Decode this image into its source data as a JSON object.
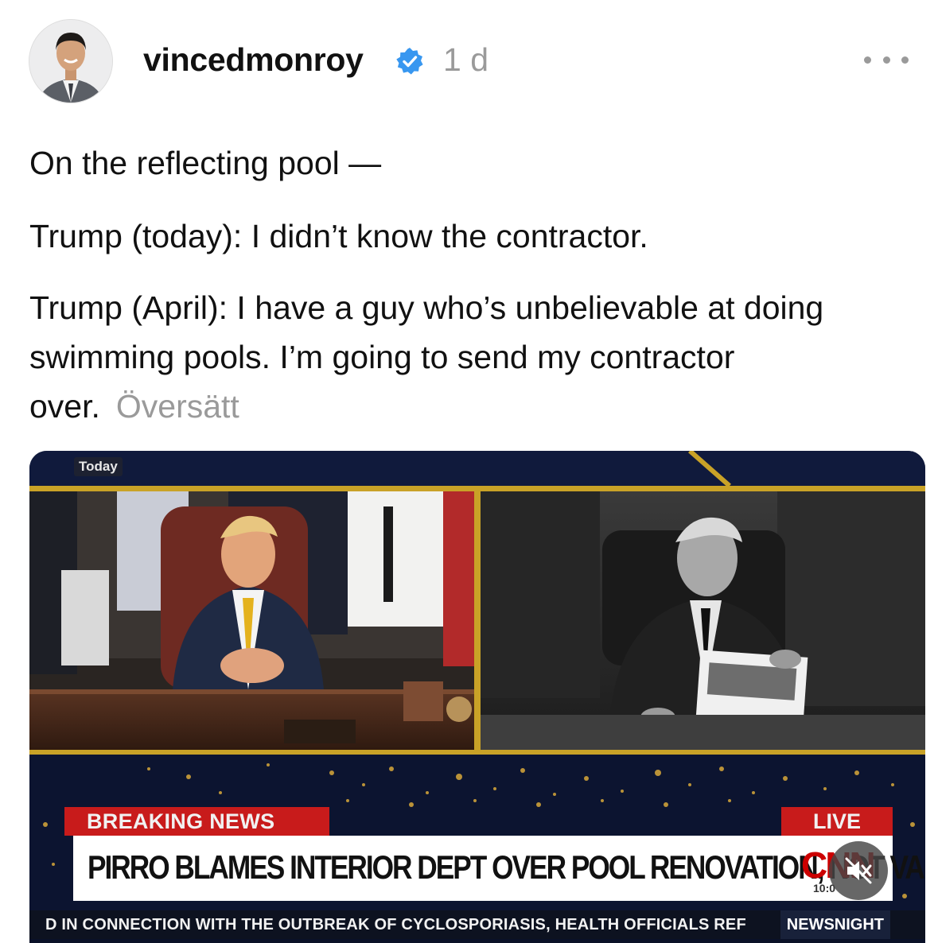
{
  "post": {
    "username": "vincedmonroy",
    "time_ago": "1 d",
    "lines": {
      "intro": "On the reflecting pool —",
      "today": "Trump (today): I didn’t know the contractor.",
      "april": "Trump (April): I have a guy who’s unbelievable at doing swimming pools. I’m going to send my contractor over."
    },
    "translate_label": "Översätt"
  },
  "icons": {
    "verified": "verified-badge-icon",
    "more": "more-options-icon",
    "mute": "muted-speaker-icon"
  },
  "video": {
    "corner_label": "Today",
    "breaking_label": "BREAKING NEWS",
    "live_label": "LIVE",
    "headline": "PIRRO BLAMES INTERIOR DEPT OVER POOL RENOVATION, NOT VANDALISM",
    "network_logo": "CNN",
    "clock": "10:0",
    "ticker": "D IN CONNECTION WITH THE OUTBREAK OF CYCLOSPORIASIS, HEALTH OFFICIALS REF",
    "show_name": "NEWSNIGHT"
  },
  "colors": {
    "verified_blue": "#3897f0",
    "cnn_red": "#cc0000",
    "breaking_red": "#c81b1b",
    "muted_text": "#9a9a9a"
  }
}
